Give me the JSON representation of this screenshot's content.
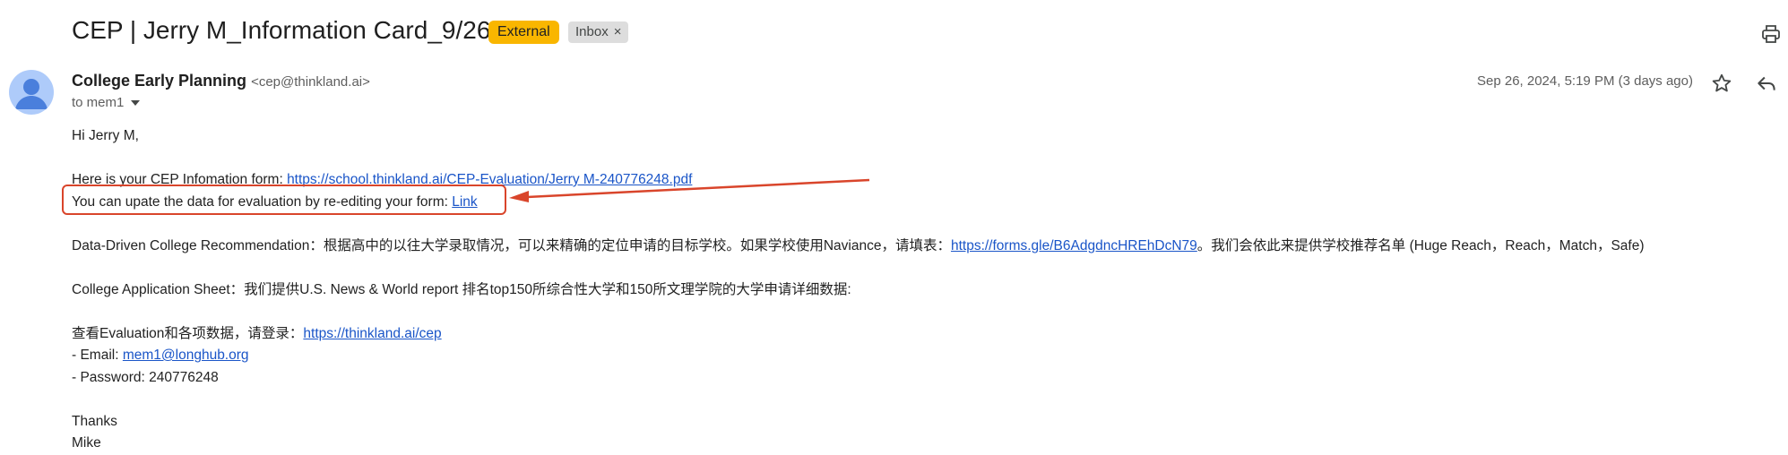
{
  "email": {
    "subject": "CEP | Jerry M_Information Card_9/26",
    "labels": {
      "external": "External",
      "inbox": "Inbox",
      "remove": "×"
    },
    "sender_name": "College Early Planning",
    "sender_email": "<cep@thinkland.ai>",
    "to": "to mem1",
    "date": "Sep 26, 2024, 5:19 PM (3 days ago)",
    "body": {
      "greeting": "Hi Jerry M,",
      "form_prefix": "Here is your CEP Infomation form: ",
      "form_link": "https://school.thinkland.ai/CEP-Evaluation/Jerry M-240776248.pdf",
      "update_prefix": "You can upate the data for evaluation by re-editing your form: ",
      "update_link": "Link",
      "recommend_prefix": "Data-Driven College Recommendation：根据高中的以往大学录取情况，可以来精确的定位申请的目标学校。如果学校使用Naviance，请填表：",
      "recommend_link": "https://forms.gle/B6AdgdncHREhDcN79",
      "recommend_suffix": "。我们会依此来提供学校推荐名单 (Huge Reach，Reach，Match，Safe)",
      "sheet_text": "College Application Sheet：我们提供U.S. News & World report 排名top150所综合性大学和150所文理学院的大学申请详细数据:",
      "login_prefix": "查看Evaluation和各项数据，请登录：",
      "login_link": "https://thinkland.ai/cep",
      "email_prefix": "- Email: ",
      "email_link": "mem1@longhub.org",
      "password_line": "- Password: 240776248",
      "thanks": "Thanks",
      "signature": "Mike"
    }
  },
  "colors": {
    "external_badge": "#f9b600",
    "link": "#1a55c8",
    "annotation": "#d9452b"
  },
  "icons": [
    "print-icon",
    "avatar-person-icon",
    "chevron-down-icon",
    "star-icon",
    "reply-icon"
  ]
}
